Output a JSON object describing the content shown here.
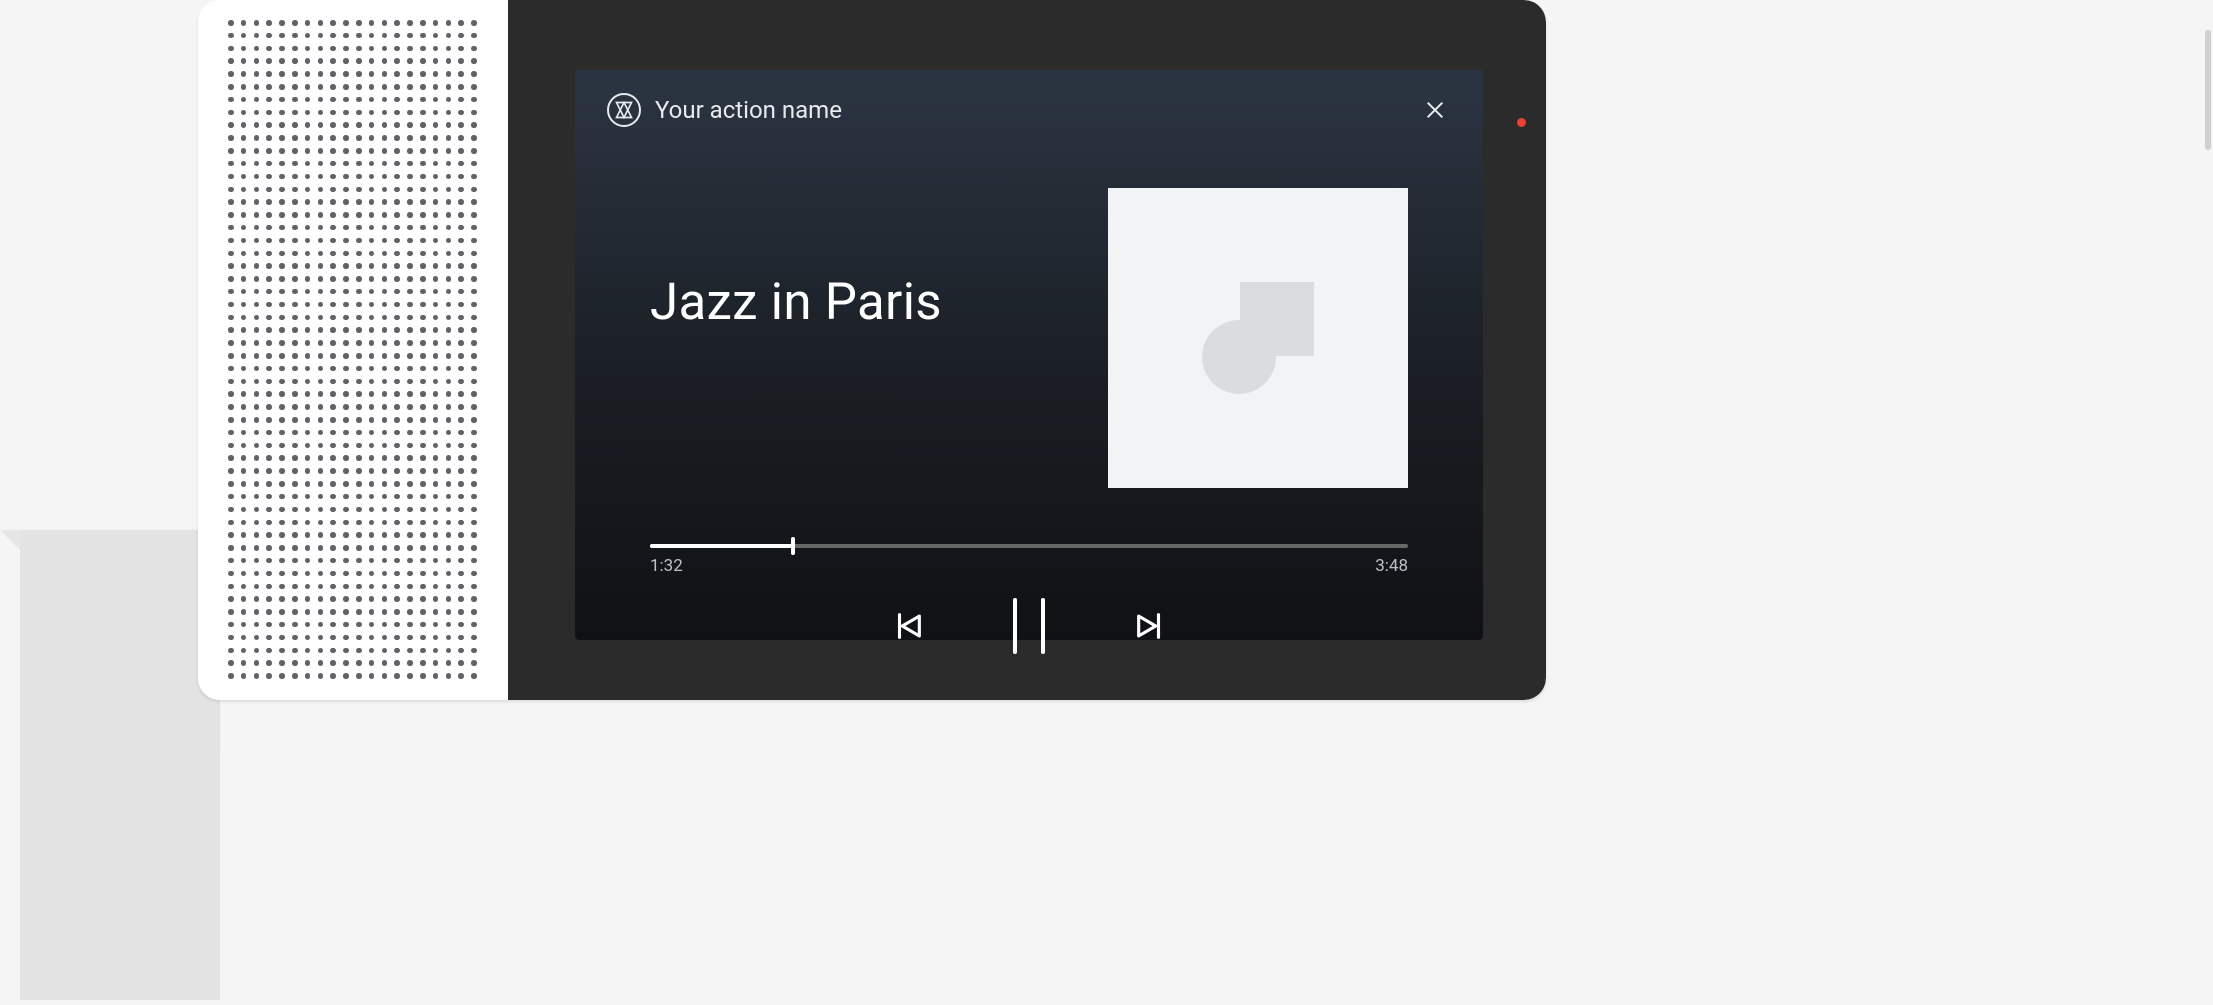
{
  "header": {
    "app_name": "Your action name",
    "app_icon": "app-logo-icon",
    "close_icon": "close-icon"
  },
  "track": {
    "title": "Jazz in Paris"
  },
  "playback": {
    "current_time": "1:32",
    "total_time": "3:48",
    "progress_percent": 18.8
  },
  "controls": {
    "prev_icon": "skip-previous-icon",
    "play_pause_icon": "pause-icon",
    "next_icon": "skip-next-icon"
  },
  "device": {
    "indicator": "red-status-dot"
  }
}
